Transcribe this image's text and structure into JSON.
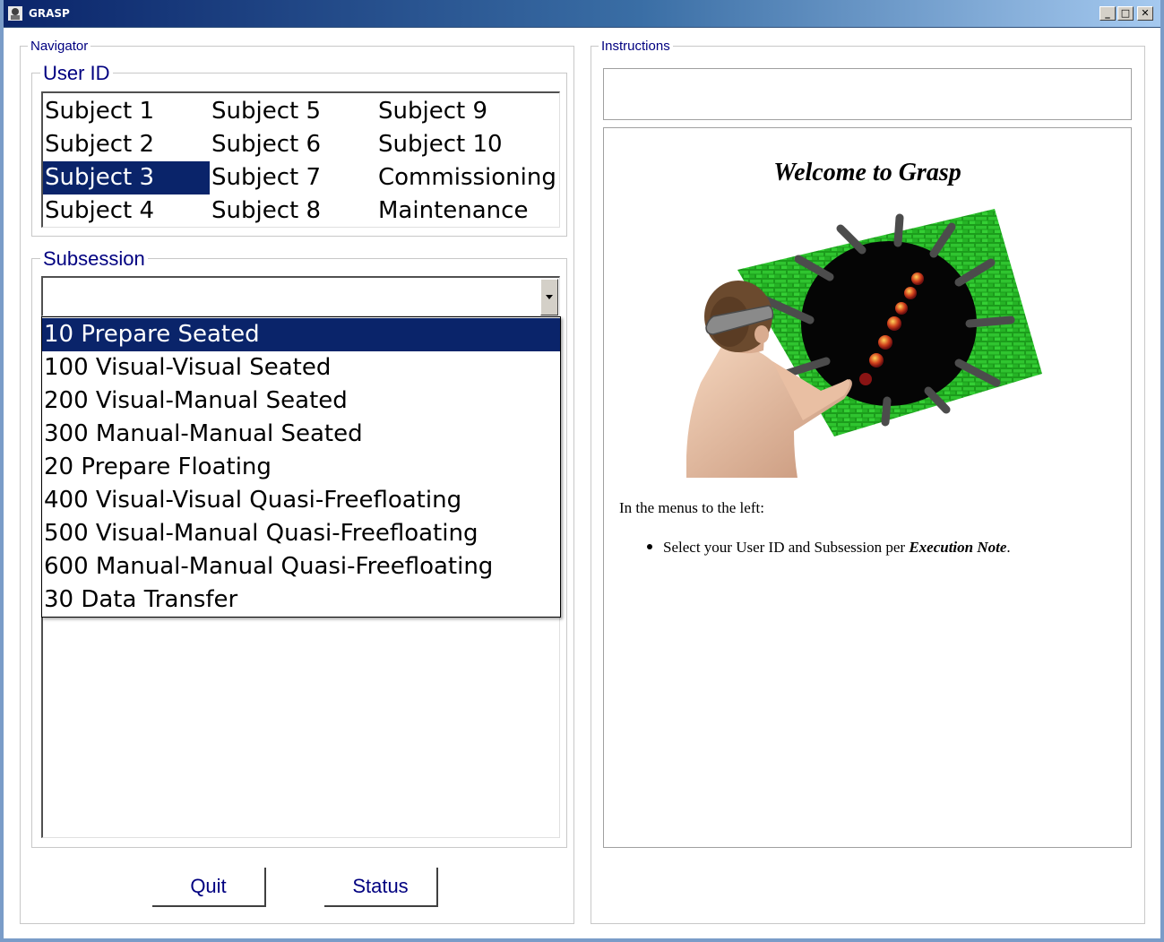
{
  "window": {
    "title": "GRASP",
    "min_label": "_",
    "max_label": "□",
    "close_label": "✕"
  },
  "navigator": {
    "label": "Navigator",
    "user_id": {
      "label": "User ID",
      "selected": "Subject 3",
      "columns": [
        [
          "Subject 1",
          "Subject 2",
          "Subject 3",
          "Subject 4"
        ],
        [
          "Subject 5",
          "Subject 6",
          "Subject 7",
          "Subject 8"
        ],
        [
          "Subject 9",
          "Subject 10",
          "Commissioning",
          "Maintenance"
        ]
      ]
    },
    "subsession": {
      "label": "Subsession",
      "value": "",
      "selected": "10 Prepare Seated",
      "options": [
        "10 Prepare Seated",
        "100 Visual-Visual Seated",
        "200 Visual-Manual Seated",
        "300 Manual-Manual Seated",
        "20 Prepare Floating",
        "400 Visual-Visual Quasi-Freefloating",
        "500 Visual-Manual Quasi-Freefloating",
        "600 Manual-Manual Quasi-Freefloating",
        "30 Data Transfer"
      ]
    }
  },
  "buttons": {
    "quit": "Quit",
    "status": "Status"
  },
  "instructions": {
    "label": "Instructions",
    "top_text": "",
    "welcome": "Welcome to Grasp",
    "intro": "In the menus to the left:",
    "bullet_prefix": "Select your User ID and Subsession per ",
    "bullet_emphasis": "Execution Note",
    "bullet_suffix": "."
  },
  "colors": {
    "selection": "#0a246a",
    "group_label": "#000080",
    "tunnel_green": "#1fae1f"
  }
}
